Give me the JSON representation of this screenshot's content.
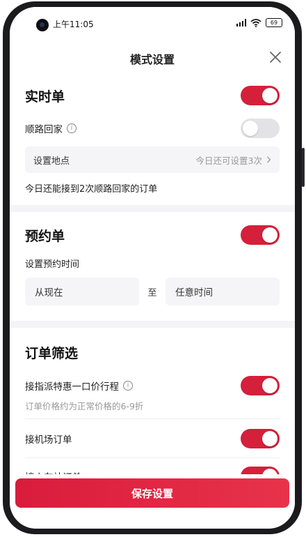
{
  "status": {
    "time": "上午11:05",
    "battery": "69"
  },
  "header": {
    "title": "模式设置"
  },
  "realtime": {
    "title": "实时单",
    "toggle_on": true,
    "return_home": {
      "label": "顺路回家",
      "toggle_on": false
    },
    "set_location": {
      "label": "设置地点",
      "value": "今日还可设置3次"
    },
    "hint": "今日还能接到2次顺路回家的订单"
  },
  "reservation": {
    "title": "预约单",
    "toggle_on": true,
    "time_label": "设置预约时间",
    "from": "从现在",
    "to_sep": "至",
    "to": "任意时间"
  },
  "filter": {
    "title": "订单筛选",
    "items": [
      {
        "label": "接指派特惠一口价行程",
        "sub": "订单价格约为正常价格的6-9折",
        "toggle_on": true
      },
      {
        "label": "接机场订单",
        "toggle_on": true
      },
      {
        "label": "接火车站订单",
        "toggle_on": true
      }
    ]
  },
  "footer": {
    "save_label": "保存设置"
  },
  "colors": {
    "accent": "#d4203a",
    "toggle_off": "#e3e3e6"
  }
}
